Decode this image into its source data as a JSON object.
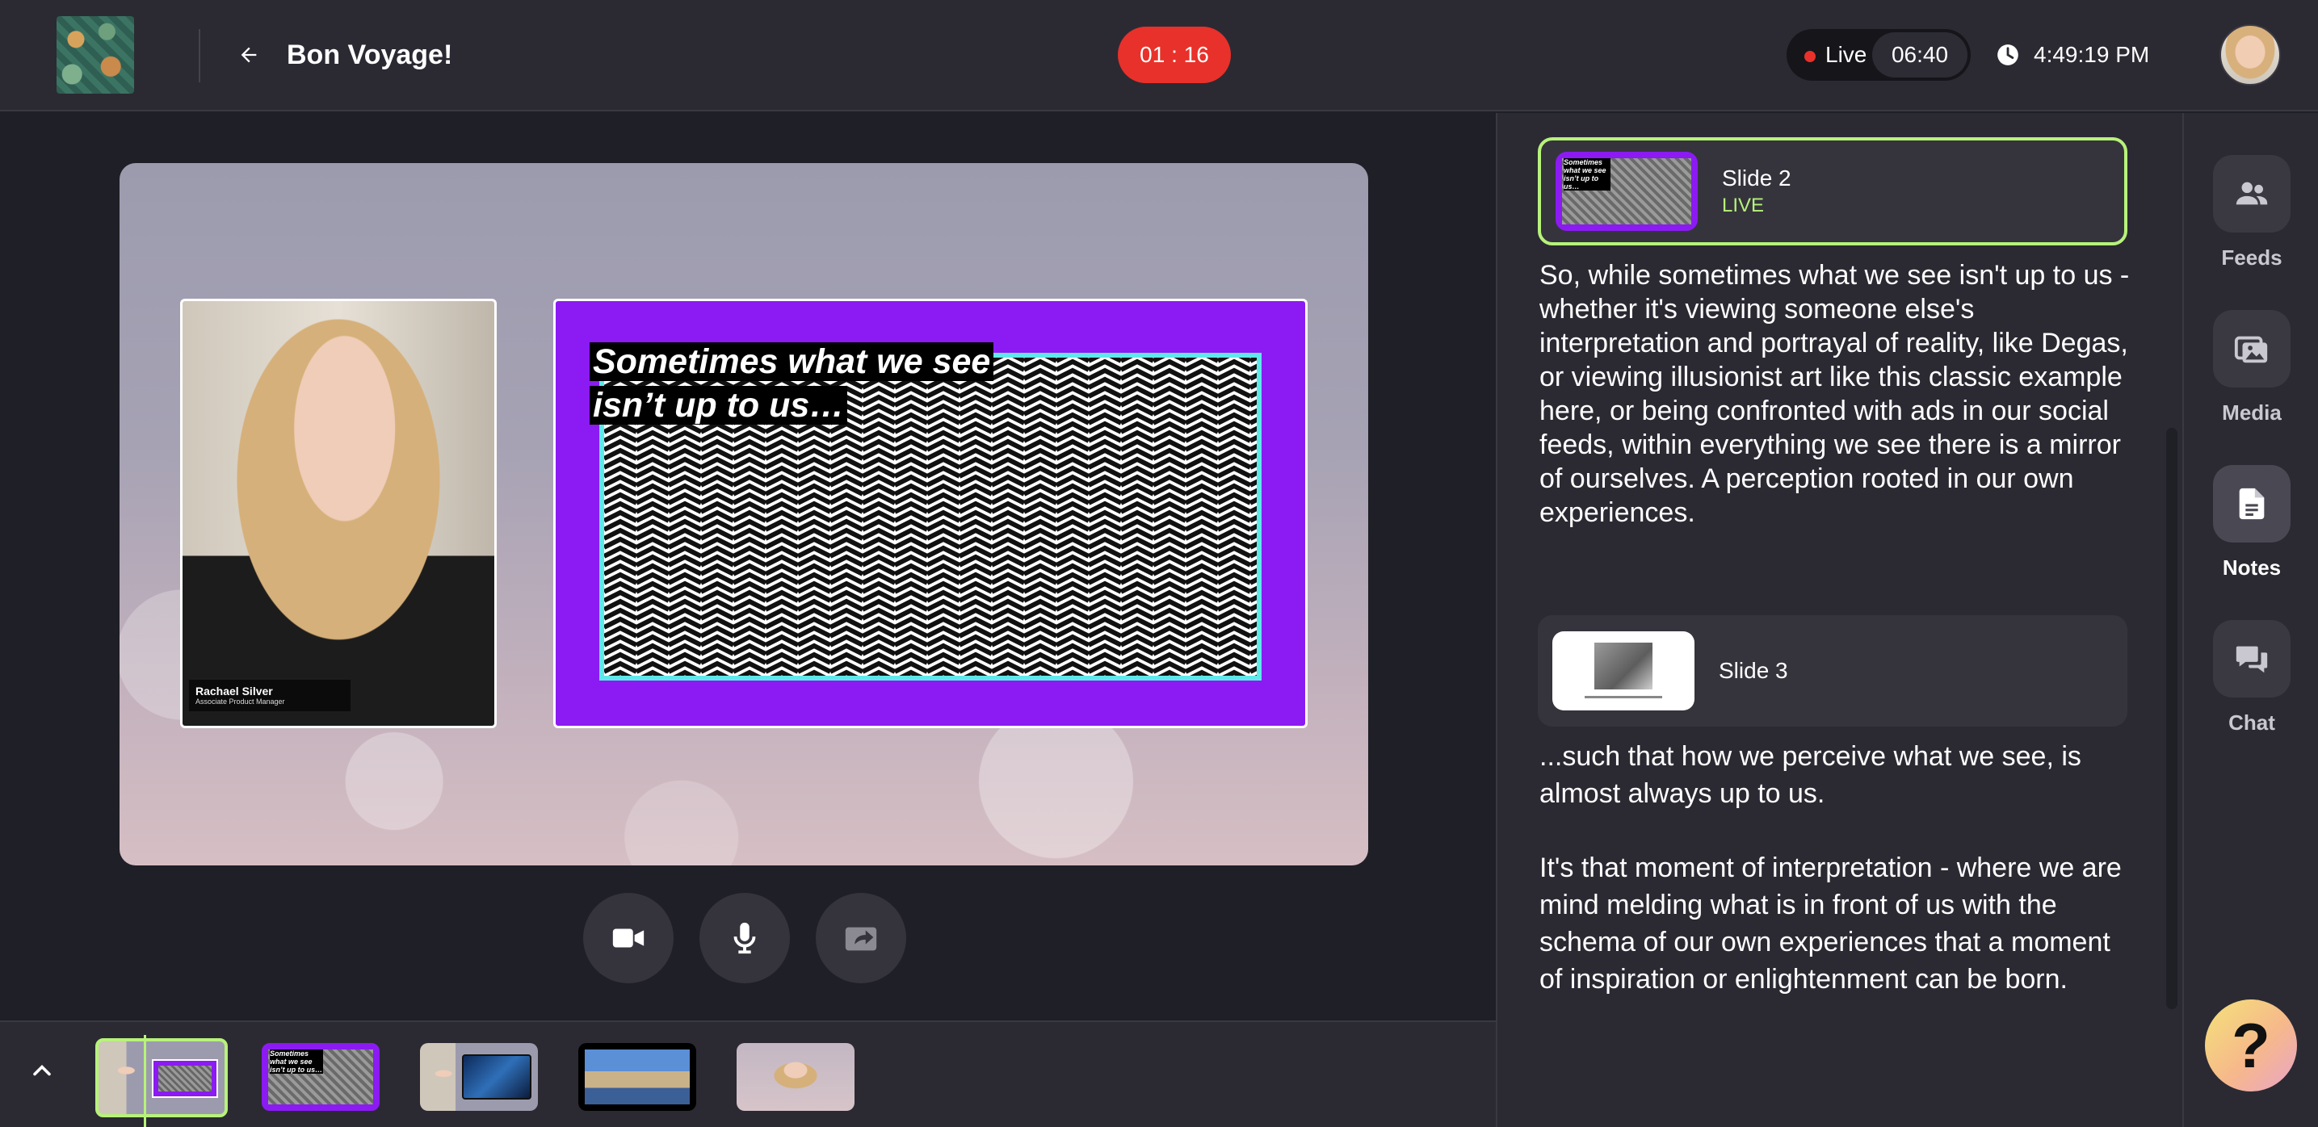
{
  "header": {
    "title": "Bon Voyage!",
    "timer": "01 : 16",
    "live_label": "Live",
    "live_time": "06:40",
    "clock_time": "4:49:19 PM"
  },
  "stage": {
    "presenter": {
      "name": "Rachael Silver",
      "role": "Associate Product Manager"
    },
    "slide_caption_line1": "Sometimes what we see",
    "slide_caption_line2": "isn’t up to us…"
  },
  "controls": {
    "camera": "camera-icon",
    "microphone": "microphone-icon",
    "share": "share-icon"
  },
  "filmstrip": {
    "thumbs": [
      {
        "kind": "presenter-and-slide",
        "active": true
      },
      {
        "kind": "slide-2",
        "caption": "Sometimes what we see isn’t up to us…"
      },
      {
        "kind": "presenter-and-media"
      },
      {
        "kind": "image-bridge"
      },
      {
        "kind": "presenter-only"
      }
    ]
  },
  "notes": {
    "current": {
      "title": "Slide 2",
      "status": "LIVE",
      "thumb_caption": "Sometimes what we see isn’t up to us…",
      "text": "So, while sometimes what we see isn't up to us - whether it's viewing someone else's interpretation and portrayal of reality, like Degas, or viewing illusionist art like this classic example here, or being confronted with ads in our social feeds, within everything we see there is a mirror of ourselves. A perception rooted in our own experiences."
    },
    "next": {
      "title": "Slide 3",
      "text_p1": "...such that how we perceive what we see, is almost always up to us.",
      "text_p2": "It's that moment of interpretation - where we are mind melding what is in front of us with the schema of our own experiences that a moment of inspiration or enlightenment can be born."
    }
  },
  "rail": {
    "items": [
      {
        "label": "Feeds",
        "icon": "people-icon"
      },
      {
        "label": "Media",
        "icon": "images-icon"
      },
      {
        "label": "Notes",
        "icon": "document-icon",
        "active": true
      },
      {
        "label": "Chat",
        "icon": "chat-icon"
      }
    ],
    "help_label": "?"
  },
  "colors": {
    "accent_live": "#b7f27a",
    "timer_red": "#e8312a",
    "slide_purple": "#8b1bf2",
    "slide_cyan": "#5ee8ea"
  }
}
